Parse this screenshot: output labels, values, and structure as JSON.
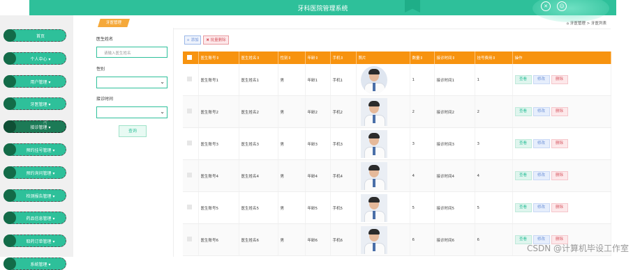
{
  "header": {
    "title": "牙科医院管理系统",
    "icons": [
      "close-icon",
      "user-icon"
    ]
  },
  "sidebar": {
    "items": [
      {
        "label": "首页"
      },
      {
        "label": "个人中心 ▾"
      },
      {
        "label": "用户管理 ▾"
      },
      {
        "label": "牙医管理 ▾"
      },
      {
        "label": "接诊管理 ▾",
        "active": true
      },
      {
        "label": "预约挂号管理 ▾"
      },
      {
        "label": "预约询问管理 ▾"
      },
      {
        "label": "检测报告管理 ▾"
      },
      {
        "label": "药品信息管理 ▾"
      },
      {
        "label": "取药订单管理 ▾"
      },
      {
        "label": "系统管理 ▾"
      }
    ]
  },
  "tab": {
    "label": "牙医管理"
  },
  "breadcrumb": {
    "text": "牙医管理 > 牙医列表"
  },
  "search": {
    "name_label": "医生姓名",
    "name_placeholder": "请输入医生姓名",
    "gender_label": "性别",
    "time_label": "接诊时间",
    "button": "查询"
  },
  "toolbar": {
    "add": "+ 添加",
    "batch_delete": "✖ 批量删除"
  },
  "table": {
    "headers": [
      "医生账号⇕",
      "医生姓名⇕",
      "性别⇕",
      "年龄⇕",
      "手机⇕",
      "照片",
      "数量⇕",
      "接诊时间⇕",
      "挂号费用⇕",
      "操作"
    ],
    "actions": {
      "view": "查看",
      "edit": "修改",
      "delete": "删除"
    },
    "rows": [
      {
        "account": "医生账号1",
        "name": "医生姓名1",
        "gender": "男",
        "age": "年龄1",
        "phone": "手机1",
        "count": "1",
        "time": "接诊时间1",
        "fee": "1"
      },
      {
        "account": "医生账号2",
        "name": "医生姓名2",
        "gender": "男",
        "age": "年龄2",
        "phone": "手机2",
        "count": "2",
        "time": "接诊时间2",
        "fee": "2"
      },
      {
        "account": "医生账号3",
        "name": "医生姓名3",
        "gender": "男",
        "age": "年龄3",
        "phone": "手机3",
        "count": "3",
        "time": "接诊时间3",
        "fee": "3"
      },
      {
        "account": "医生账号4",
        "name": "医生姓名4",
        "gender": "男",
        "age": "年龄4",
        "phone": "手机4",
        "count": "4",
        "time": "接诊时间4",
        "fee": "4"
      },
      {
        "account": "医生账号5",
        "name": "医生姓名5",
        "gender": "男",
        "age": "年龄5",
        "phone": "手机5",
        "count": "5",
        "time": "接诊时间5",
        "fee": "5"
      },
      {
        "account": "医生账号6",
        "name": "医生姓名6",
        "gender": "男",
        "age": "年龄6",
        "phone": "手机6",
        "count": "6",
        "time": "接诊时间6",
        "fee": "6"
      }
    ]
  },
  "watermark": "CSDN @计算机毕设工作室",
  "colors": {
    "primary": "#2ec09a",
    "header_orange": "#f7930f",
    "sidebar_dot": "#136b48"
  }
}
